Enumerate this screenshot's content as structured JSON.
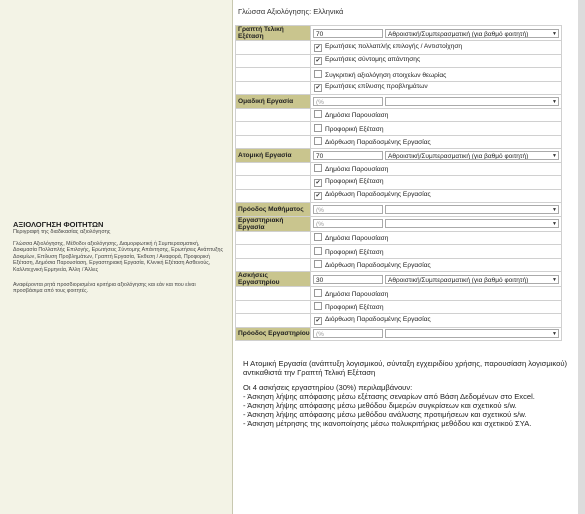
{
  "left": {
    "title": "ΑΞΙΟΛΟΓΗΣΗ ΦΟΙΤΗΤΩΝ",
    "subtitle": "Περιγραφή της διαδικασίας αξιολόγησης",
    "description": "Γλώσσα Αξιολόγησης, Μέθοδοι αξιολόγησης, Διαμορφωτική ή Συμπερασματική, Δοκιμασία Πολλαπλής Επιλογής, Ερωτήσεις Σύντομης Απάντησης, Ερωτήσεις Ανάπτυξης Δοκιμίων, Επίλυση Προβλημάτων, Γραπτή Εργασία, Έκθεση / Αναφορά, Προφορική Εξέταση, Δημόσια Παρουσίαση, Εργαστηριακή Εργασία, Κλινική Εξέταση Ασθενούς, Καλλιτεχνική Ερμηνεία, Άλλη / Άλλες",
    "note": "Αναφέρονται ρητά προσδιορισμένα κριτήρια αξιολόγησης και εάν και που είναι προσβάσιμα από τους φοιτητές."
  },
  "language_line": "Γλώσσα Αξιολόγησης: Ελληνικά",
  "rows": [
    {
      "kind": "header",
      "label": "Γραπτή Τελική Εξέταση",
      "value": "70",
      "placeholder": "",
      "select": "Αθροιστική/Συμπερασματική (για βαθμό φοιτητή)"
    },
    {
      "kind": "check",
      "checked": true,
      "label": "Ερωτήσεις πολλαπλής επιλογής / Αντιστοίχηση"
    },
    {
      "kind": "check",
      "checked": true,
      "label": "Ερωτήσεις σύντομης απάντησης"
    },
    {
      "kind": "check",
      "checked": false,
      "label": "Συγκριτική αξιολόγηση στοιχείων θεωρίας"
    },
    {
      "kind": "check",
      "checked": true,
      "label": "Ερωτήσεις επίλυσης προβλημάτων"
    },
    {
      "kind": "header",
      "label": "Ομαδική Εργασία",
      "value": "",
      "placeholder": "(%",
      "select": ""
    },
    {
      "kind": "check",
      "checked": false,
      "label": "Δημόσια Παρουσίαση"
    },
    {
      "kind": "check",
      "checked": false,
      "label": "Προφορική Εξέταση"
    },
    {
      "kind": "check",
      "checked": false,
      "label": "Διόρθωση Παραδοσμένης Εργασίας"
    },
    {
      "kind": "header",
      "label": "Ατομική Εργασία",
      "value": "70",
      "placeholder": "",
      "select": "Αθροιστική/Συμπερασματική (για βαθμό φοιτητή)"
    },
    {
      "kind": "check",
      "checked": false,
      "label": "Δημόσια Παρουσίαση"
    },
    {
      "kind": "check",
      "checked": true,
      "label": "Προφορική Εξέταση"
    },
    {
      "kind": "check",
      "checked": true,
      "label": "Διόρθωση Παραδοσμένης Εργασίας"
    },
    {
      "kind": "header",
      "label": "Πρόοδος Μαθήματος",
      "value": "",
      "placeholder": "(%",
      "select": ""
    },
    {
      "kind": "header",
      "label": "Εργαστηριακή Εργασία",
      "value": "",
      "placeholder": "(%",
      "select": ""
    },
    {
      "kind": "check",
      "checked": false,
      "label": "Δημόσια Παρουσίαση"
    },
    {
      "kind": "check",
      "checked": false,
      "label": "Προφορική Εξέταση"
    },
    {
      "kind": "check",
      "checked": false,
      "label": "Διόρθωση Παραδοσμένης Εργασίας"
    },
    {
      "kind": "header",
      "label": "Ασκήσεις Εργαστηρίου",
      "value": "30",
      "placeholder": "",
      "select": "Αθροιστική/Συμπερασματική (για βαθμό φοιτητή)"
    },
    {
      "kind": "check",
      "checked": false,
      "label": "Δημόσια Παρουσίαση"
    },
    {
      "kind": "check",
      "checked": false,
      "label": "Προφορική Εξέταση"
    },
    {
      "kind": "check",
      "checked": true,
      "label": "Διόρθωση Παραδοσμένης Εργασίας"
    },
    {
      "kind": "header",
      "label": "Πρόοδος Εργαστηρίου",
      "value": "",
      "placeholder": "(%",
      "select": ""
    }
  ],
  "notes": {
    "p1": "Η Ατομική Εργασία (ανάπτυξη λογισμικού, σύνταξη εγχειριδίου χρήσης, παρουσίαση λογισμικού) αντικαθιστά την Γραπτή Τελική Εξέταση",
    "p2": "Οι 4 ασκήσεις εργαστηρίου (30%) περιλαμβάνουν:",
    "items": [
      "- Άσκηση λήψης απόφασης μέσω εξέτασης σεναρίων από Βάση Δεδομένων στο Excel.",
      "- Άσκηση λήψης απόφασης μέσω μεθόδου διμερών συγκρίσεων και σχετικού s/w.",
      "- Άσκηση λήψης απόφασης μέσω μεθόδου ανάλυσης προτιμήσεων και σχετικού s/w.",
      "- Άσκηση μέτρησης της ικανοποίησης μέσω πολυκριτήριας μεθόδου και σχετικού ΣΥΑ."
    ]
  }
}
